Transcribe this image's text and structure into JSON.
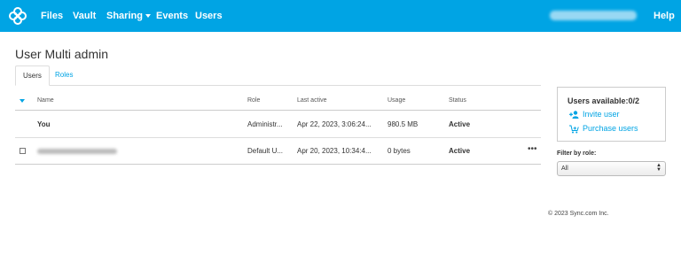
{
  "nav": {
    "items": [
      "Files",
      "Vault",
      "Sharing",
      "Events",
      "Users"
    ],
    "help": "Help",
    "brand_color": "#00a4e4"
  },
  "page": {
    "title": "User Multi admin"
  },
  "tabs": [
    {
      "label": "Users",
      "active": true
    },
    {
      "label": "Roles",
      "active": false
    }
  ],
  "table": {
    "columns": [
      "Name",
      "Role",
      "Last active",
      "Usage",
      "Status"
    ],
    "rows": [
      {
        "name": "You",
        "role": "Administr...",
        "last_active": "Apr 22, 2023, 3:06:24...",
        "usage": "980.5 MB",
        "status": "Active"
      },
      {
        "name": "",
        "role": "Default U...",
        "last_active": "Apr 20, 2023, 10:34:4...",
        "usage": "0 bytes",
        "status": "Active"
      }
    ]
  },
  "panel": {
    "users_available": "Users available:0/2",
    "invite_label": "Invite user",
    "purchase_label": "Purchase users"
  },
  "filter": {
    "label": "Filter by role:",
    "selected": "All"
  },
  "footer": {
    "copyright": "© 2023 Sync.com Inc."
  }
}
